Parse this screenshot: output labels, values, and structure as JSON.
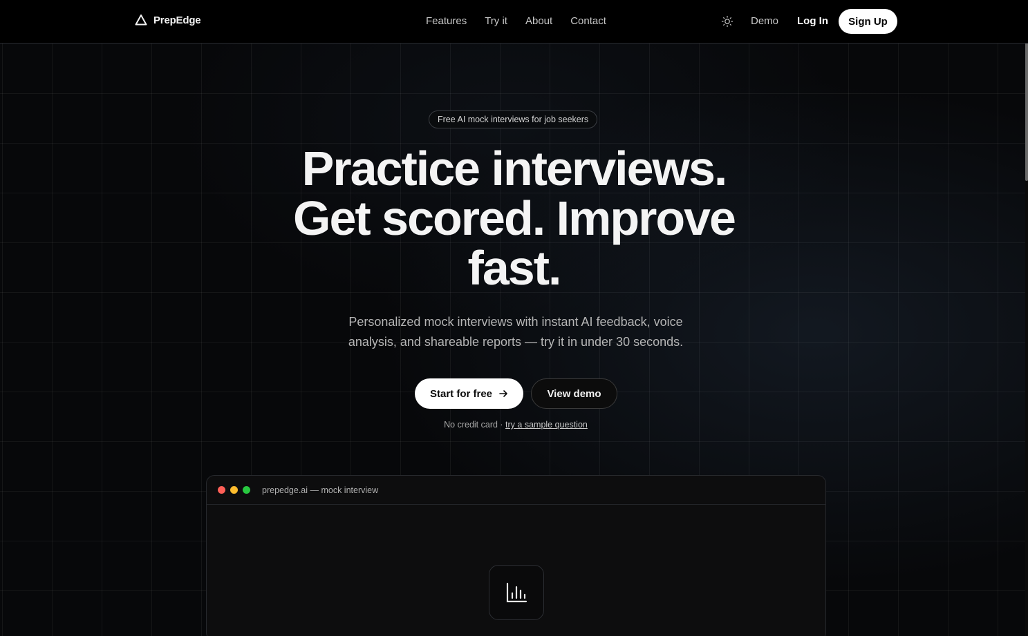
{
  "header": {
    "brand": "PrepEdge",
    "nav": [
      "Features",
      "Try it",
      "About",
      "Contact"
    ],
    "demo": "Demo",
    "login": "Log In",
    "signup": "Sign Up"
  },
  "hero": {
    "badge": "Free AI mock interviews for job seekers",
    "headline_lines": [
      "Practice interviews.",
      "Get scored. Improve",
      "fast."
    ],
    "subhead_lines": [
      "Personalized mock interviews with instant AI feedback, voice",
      "analysis, and shareable reports — try it in under 30 seconds."
    ],
    "cta_primary": "Start for free",
    "cta_primary_icon": "arrow-right-icon",
    "cta_secondary": "View demo",
    "note_prefix": "No credit card · ",
    "note_link": "try a sample question"
  },
  "mock_window": {
    "title": "prepedge.ai — mock interview",
    "dot_colors": [
      "#ff5f57",
      "#febc2e",
      "#28c840"
    ],
    "center_icon": "bar-chart-icon"
  },
  "colors": {
    "background": "#07080a",
    "accent": "#ffffff",
    "text_muted": "#b5b5b5"
  }
}
